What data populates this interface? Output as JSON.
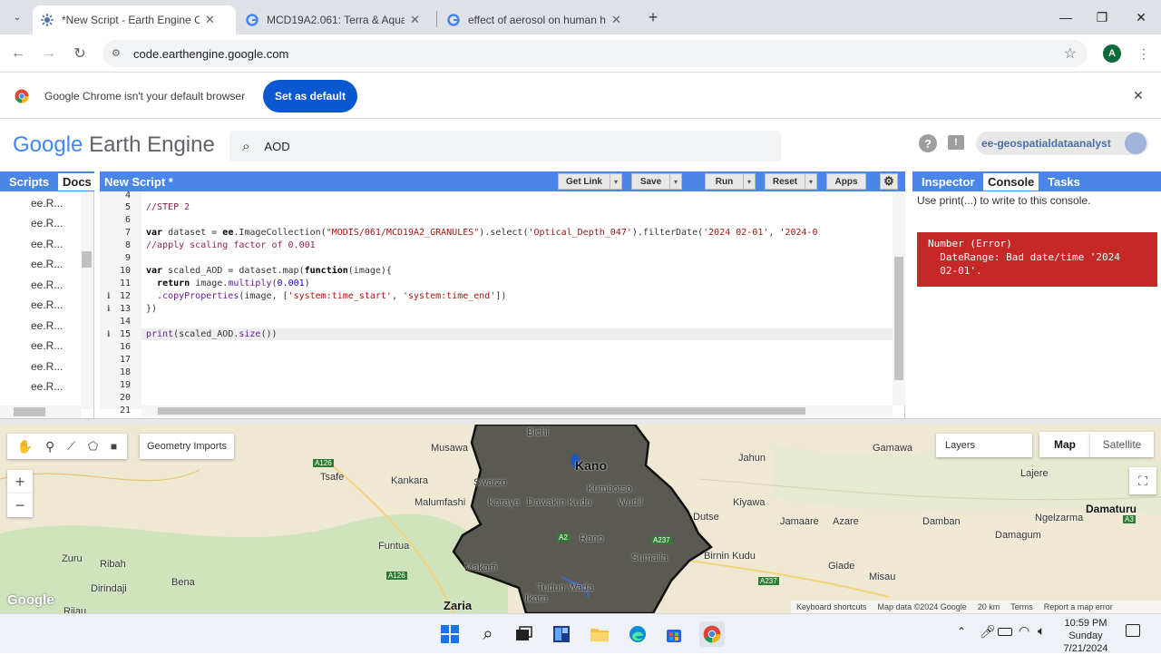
{
  "browser": {
    "tabs": [
      {
        "title": "*New Script - Earth Engine Code Editor",
        "active": true
      },
      {
        "title": "MCD19A2.061: Terra & Aqua MAIAC Land Aerosol",
        "active": false
      },
      {
        "title": "effect of aerosol on human health",
        "active": false
      }
    ],
    "url": "code.earthengine.google.com",
    "profile_initial": "A"
  },
  "infobar": {
    "message": "Google Chrome isn't your default browser",
    "button": "Set as default"
  },
  "gee": {
    "logo_google": "Google",
    "logo_product": "Earth Engine",
    "search_value": "AOD",
    "account": "ee-geospatialdataanalyst"
  },
  "left_panel": {
    "tabs": [
      "Scripts",
      "Docs"
    ],
    "items": [
      "ee.R...",
      "ee.R...",
      "ee.R...",
      "ee.R...",
      "ee.R...",
      "ee.R...",
      "ee.R...",
      "ee.R...",
      "ee.R...",
      "ee.R..."
    ]
  },
  "editor": {
    "title": "New Script *",
    "buttons": {
      "get_link": "Get Link",
      "save": "Save",
      "run": "Run",
      "reset": "Reset",
      "apps": "Apps"
    },
    "line_numbers": [
      "4",
      "5",
      "6",
      "7",
      "8",
      "9",
      "10",
      "11",
      "12",
      "13",
      "14",
      "15",
      "16",
      "17",
      "18",
      "19",
      "20",
      "21"
    ]
  },
  "console": {
    "tabs": [
      "Inspector",
      "Console",
      "Tasks"
    ],
    "hint": "Use print(...) to write to this console.",
    "error_line1": "Number (Error)",
    "error_line2": "  DateRange: Bad date/time '2024",
    "error_line3": "  02-01'."
  },
  "map": {
    "geometry_imports": "Geometry Imports",
    "layers": "Layers",
    "map_type_options": [
      "Map",
      "Satellite"
    ],
    "zoom_in": "+",
    "zoom_out": "−",
    "places": [
      "Bichi",
      "Kano",
      "Kumbotso",
      "Musawa",
      "Tsafe",
      "Kankara",
      "Malumfashi",
      "Funtua",
      "Zuru",
      "Ribah",
      "Bena",
      "Dirindaji",
      "Zaria",
      "Ikara",
      "Karaye",
      "Dawakin Kudu",
      "Wudil",
      "Rano",
      "Sumaila",
      "Makarfi",
      "Tudun Wada",
      "Gamawa",
      "Jahun",
      "Kiyawa",
      "Dutse",
      "Jamaare",
      "Azare",
      "Birnin Kudu",
      "Giade",
      "Misau",
      "Damban",
      "Lajere",
      "Damaturu",
      "Ngelzarma",
      "Damagum",
      "Swarzo",
      "Riiau"
    ],
    "roads": [
      "A126",
      "A126",
      "A237",
      "A237",
      "A3",
      "A2"
    ],
    "footer": {
      "shortcuts": "Keyboard shortcuts",
      "data": "Map data ©2024 Google",
      "scale": "20 km",
      "terms": "Terms",
      "report": "Report a map error"
    },
    "google_logo": "Google"
  },
  "taskbar": {
    "time": "10:59 PM",
    "day": "Sunday",
    "date": "7/21/2024"
  },
  "colors": {
    "gee_blue": "#4a86e8",
    "error_red": "#c62828",
    "chrome_blue": "#0b57d0",
    "region_fill": "#5a5a52"
  }
}
